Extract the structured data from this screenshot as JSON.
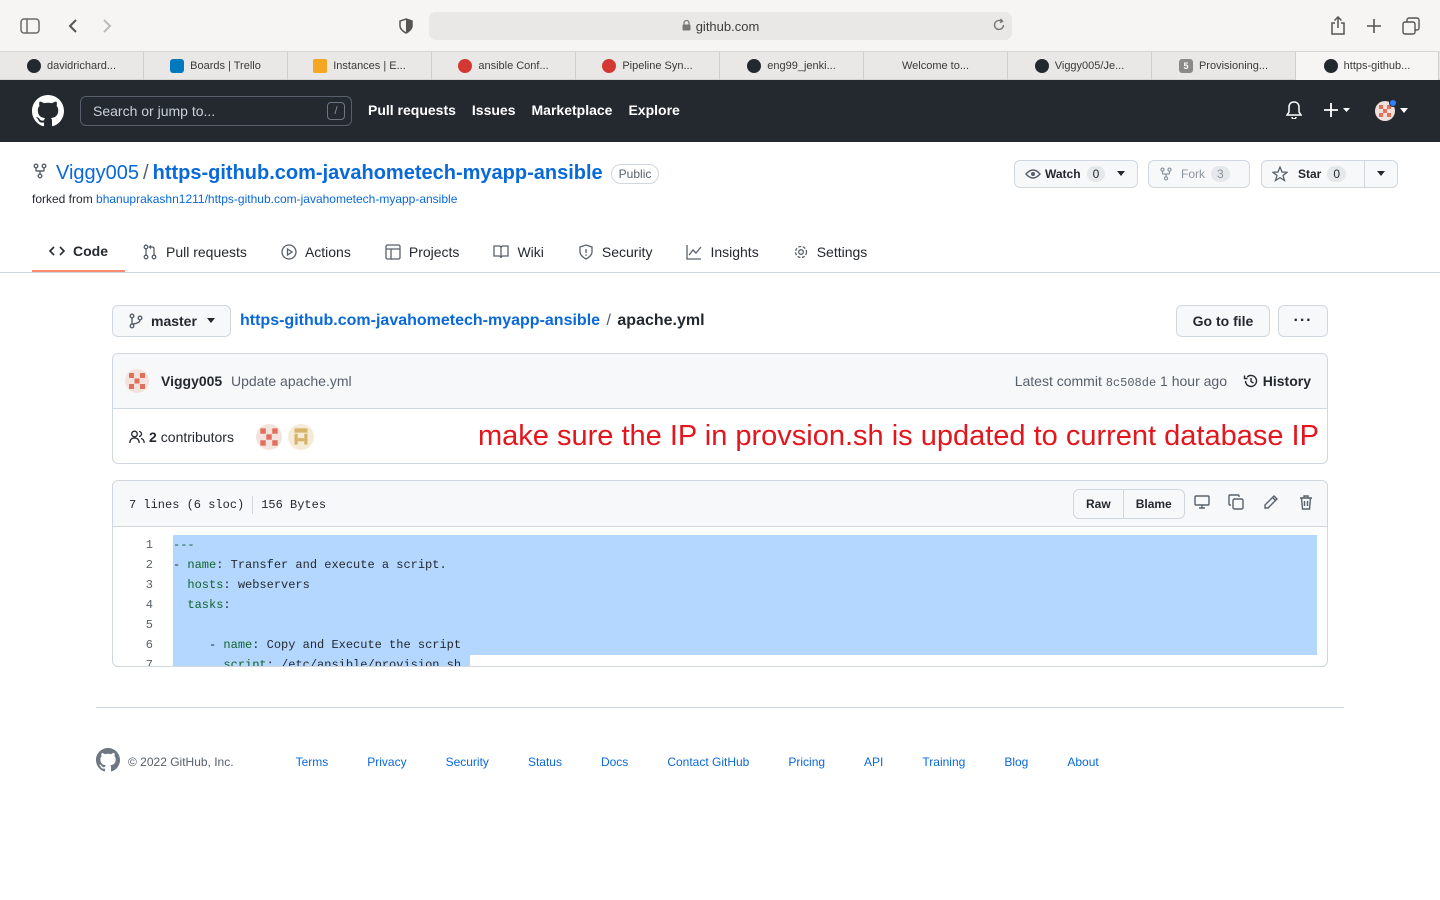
{
  "browser": {
    "url": "github.com",
    "tabs": [
      {
        "label": "davidrichard...",
        "favicon": "github-icon"
      },
      {
        "label": "Boards | Trello",
        "favicon": "trello-icon"
      },
      {
        "label": "Instances | E...",
        "favicon": "aws-icon"
      },
      {
        "label": "ansible Conf...",
        "favicon": "jenkins-icon"
      },
      {
        "label": "Pipeline Syn...",
        "favicon": "jenkins-icon"
      },
      {
        "label": "eng99_jenki...",
        "favicon": "github-icon"
      },
      {
        "label": "Welcome to...",
        "favicon": ""
      },
      {
        "label": "Viggy005/Je...",
        "favicon": "github-icon"
      },
      {
        "label": "Provisioning...",
        "favicon": "letter-5-icon"
      },
      {
        "label": "https-github...",
        "favicon": "github-icon",
        "active": true
      }
    ]
  },
  "header": {
    "search_placeholder": "Search or jump to...",
    "search_shortcut": "/",
    "nav": [
      "Pull requests",
      "Issues",
      "Marketplace",
      "Explore"
    ]
  },
  "repo": {
    "owner": "Viggy005",
    "separator": "/",
    "name": "https-github.com-javahometech-myapp-ansible",
    "visibility": "Public",
    "forked_prefix": "forked from",
    "forked_from": "bhanuprakashn1211/https-github.com-javahometech-myapp-ansible",
    "watch_label": "Watch",
    "watch_count": "0",
    "fork_label": "Fork",
    "fork_count": "3",
    "star_label": "Star",
    "star_count": "0",
    "tabs": [
      "Code",
      "Pull requests",
      "Actions",
      "Projects",
      "Wiki",
      "Security",
      "Insights",
      "Settings"
    ]
  },
  "file": {
    "branch": "master",
    "repo_link": "https-github.com-javahometech-myapp-ansible",
    "path_sep": "/",
    "filename": "apache.yml",
    "go_to_file": "Go to file",
    "more": "···",
    "commit": {
      "author": "Viggy005",
      "message": "Update apache.yml",
      "latest_label": "Latest commit",
      "sha": "8c508de",
      "time": "1 hour ago",
      "history": "History"
    },
    "contributors_count": "2",
    "contributors_label": "contributors",
    "annotation": "make sure the IP in provsion.sh is updated to current database IP",
    "stats_lines": "7 lines (6 sloc)",
    "stats_size": "156 Bytes",
    "raw": "Raw",
    "blame": "Blame",
    "code_lines": [
      {
        "num": "1",
        "text": "---"
      },
      {
        "num": "2",
        "text": "- name: Transfer and execute a script."
      },
      {
        "num": "3",
        "text": "  hosts: webservers"
      },
      {
        "num": "4",
        "text": "  tasks:"
      },
      {
        "num": "5",
        "text": ""
      },
      {
        "num": "6",
        "text": "     - name: Copy and Execute the script"
      },
      {
        "num": "7",
        "text": "       script: /etc/ansible/provision.sh"
      }
    ]
  },
  "footer": {
    "copyright": "© 2022 GitHub, Inc.",
    "links": [
      "Terms",
      "Privacy",
      "Security",
      "Status",
      "Docs",
      "Contact GitHub",
      "Pricing",
      "API",
      "Training",
      "Blog",
      "About"
    ]
  },
  "colors": {
    "annotation": "#e3161d",
    "header_bg": "#24292f",
    "link": "#0969da",
    "selection": "#b3d7ff"
  }
}
